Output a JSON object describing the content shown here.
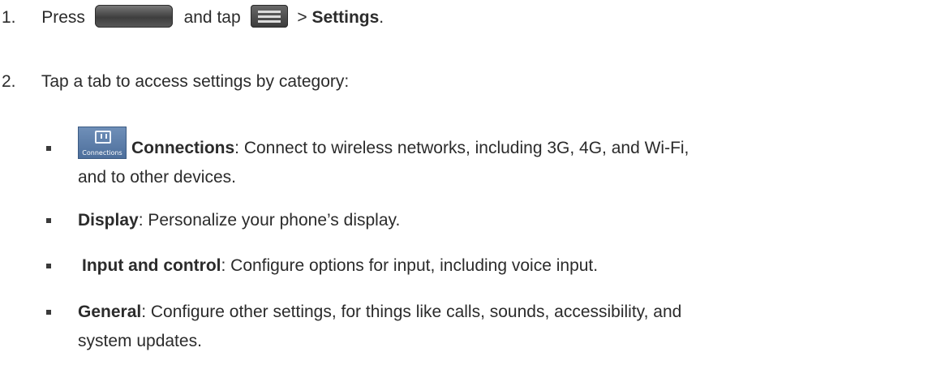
{
  "steps": [
    {
      "number": "1.",
      "text_before": "Press",
      "text_mid": "and tap",
      "text_gt": ">",
      "bold": "Settings",
      "text_after": "."
    },
    {
      "number": "2.",
      "text": "Tap a tab to access settings by category:"
    }
  ],
  "icons": {
    "home_key": "home-key-icon",
    "menu_key": "menu-key-icon",
    "connections_tab": "connections-tab-icon",
    "connections_tab_caption": "Connections"
  },
  "categories": [
    {
      "title": "Connections",
      "desc_line1": ": Connect to wireless networks, including 3G, 4G, and Wi-Fi,",
      "desc_line2": "and to other devices."
    },
    {
      "title": "Display",
      "desc": ": Personalize your phone’s display."
    },
    {
      "title": "Input and control",
      "desc": ": Configure options for input, including voice input."
    },
    {
      "title": "General",
      "desc_line1": ": Configure other settings, for things like calls, sounds, accessibility, and",
      "desc_line2": "system updates."
    }
  ]
}
